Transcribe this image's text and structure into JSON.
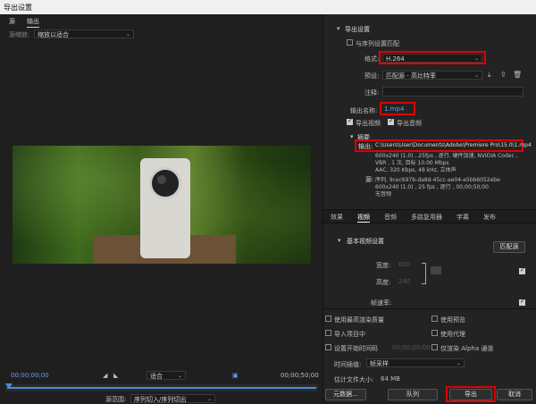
{
  "window": {
    "title": "导出设置"
  },
  "left": {
    "tabs": [
      "源",
      "输出"
    ],
    "source_scale_label": "源缩放:",
    "source_scale_value": "缩放以适合",
    "timecode_start": "00;00;00;00",
    "fit_value": "适合",
    "timecode_end": "00;00;50;00",
    "source_range_label": "源范围:",
    "source_range_value": "序列切入/序列切出"
  },
  "right": {
    "export_settings_label": "导出设置",
    "match_sequence_label": "与序列设置匹配",
    "format_label": "格式:",
    "format_value": "H.264",
    "preset_label": "预设:",
    "preset_value": "匹配源 - 高比特率",
    "comment_label": "注释:",
    "output_name_label": "输出名称:",
    "output_name_value": "1.mp4",
    "export_video_label": "导出视频",
    "export_audio_label": "导出音频",
    "summary_label": "摘要",
    "output_label": "输出:",
    "output_path": "C:\\Users\\User\\Documents\\Adobe\\Premiere Pro\\15.0\\1.mp4",
    "output_line2": "600x240 (1.0) , 25fps , 逐行, 硬件加速, NVIDIA Codec ,",
    "output_line3": "VBR , 1 次, 目标 10.00 Mbps",
    "output_line4": "AAC, 320 Kbps, 48 kHz, 立体声",
    "source_label": "源:",
    "source_line1": "序列, 9cec697b-da8d-45cc-ae04-e5bb6052ebe",
    "source_line2": "600x240 (1.0) , 25 fps , 逐行 , 00;00;50;00",
    "source_line3": "无音频",
    "panel_tabs": [
      "效果",
      "视频",
      "音频",
      "多路复用器",
      "字幕",
      "发布"
    ],
    "basic_video_label": "基本视频设置",
    "match_source_btn": "匹配源",
    "width_label": "宽度:",
    "width_value": "600",
    "height_label": "高度:",
    "height_value": "240",
    "framerate_label": "帧速率:",
    "max_render_label": "使用最高渲染质量",
    "use_preview_label": "使用预览",
    "import_project_label": "导入项目中",
    "use_proxy_label": "使用代理",
    "set_start_tc_label": "设置开始时间码",
    "start_tc_value": "00;00;00;00",
    "alpha_label": "仅渲染 Alpha 通道",
    "time_interp_label": "时间插值:",
    "time_interp_value": "帧采样",
    "filesize_label": "估计文件大小:",
    "filesize_value": "64 MB",
    "metadata_btn": "元数据...",
    "queue_btn": "队列",
    "export_btn": "导出",
    "cancel_btn": "取消"
  }
}
